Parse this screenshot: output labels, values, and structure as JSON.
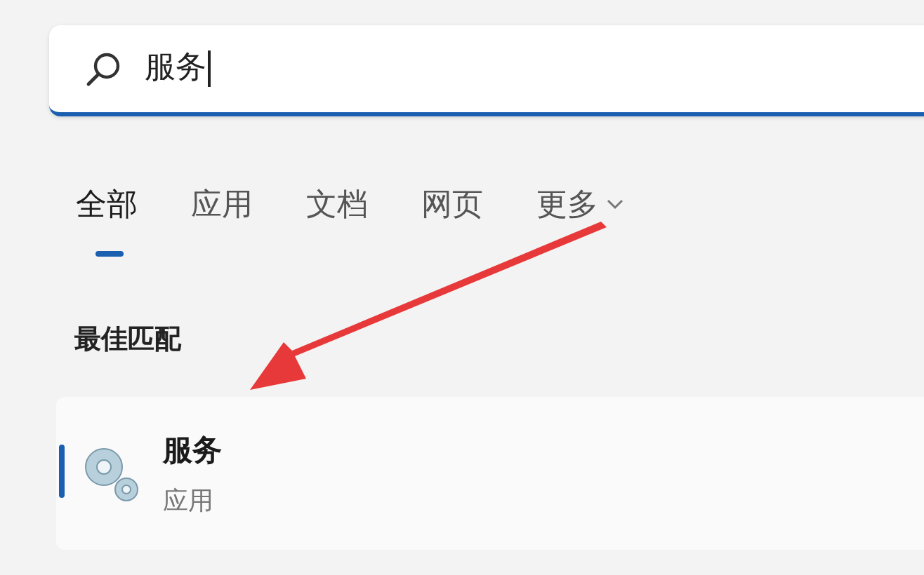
{
  "search": {
    "value": "服务"
  },
  "tabs": [
    {
      "label": "全部",
      "selected": true
    },
    {
      "label": "应用",
      "selected": false
    },
    {
      "label": "文档",
      "selected": false
    },
    {
      "label": "网页",
      "selected": false
    },
    {
      "label": "更多",
      "selected": false,
      "kind": "dropdown"
    }
  ],
  "section_title": "最佳匹配",
  "best_match": {
    "title": "服务",
    "subtitle": "应用",
    "selected": true
  }
}
